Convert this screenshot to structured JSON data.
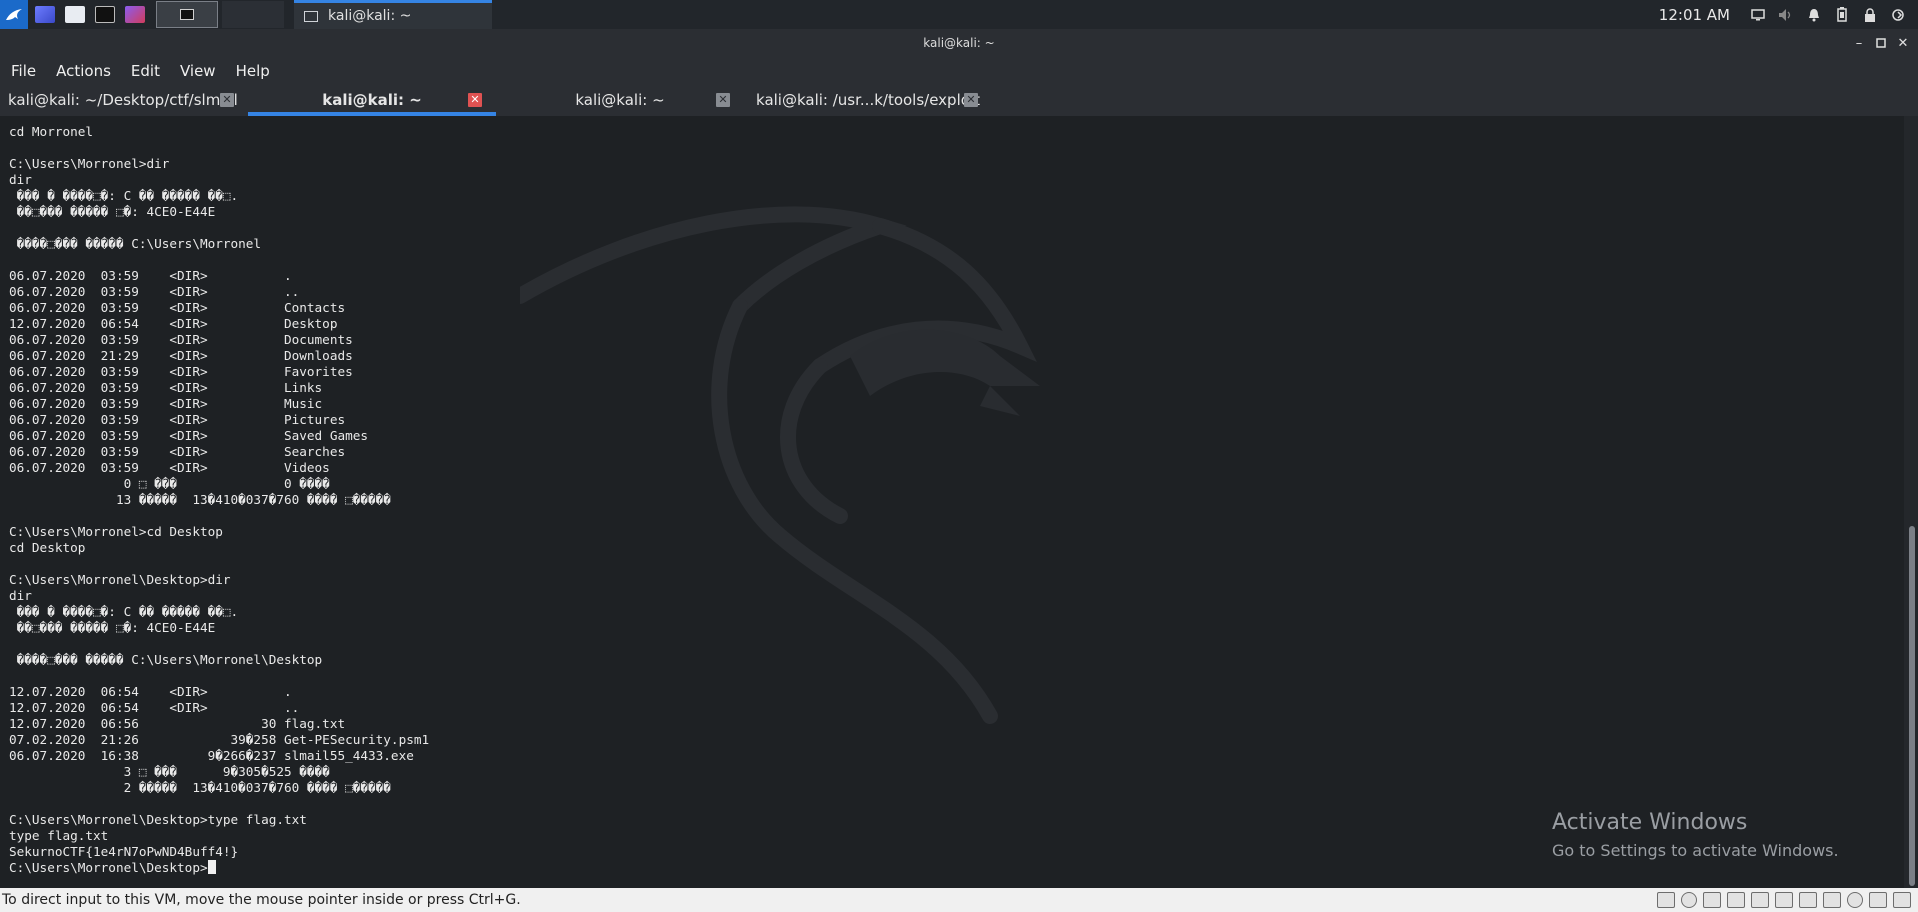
{
  "taskbar": {
    "task_label": "kali@kali: ~",
    "clock": "12:01 AM"
  },
  "window": {
    "title": "kali@kali: ~"
  },
  "menu": [
    "File",
    "Actions",
    "Edit",
    "View",
    "Help"
  ],
  "tabs": [
    {
      "label": "kali@kali: ~/Desktop/ctf/slmail",
      "active": false
    },
    {
      "label": "kali@kali: ~",
      "active": true
    },
    {
      "label": "kali@kali: ~",
      "active": false
    },
    {
      "label": "kali@kali: /usr...k/tools/exploit",
      "active": false
    }
  ],
  "terminal": {
    "lines": [
      "cd Morronel",
      "",
      "C:\\Users\\Morronel>dir",
      "dir",
      " ��� � ����⬚�: C �� ����� ��⬚.",
      " ��⬚��� ����� ⬚�: 4CE0-E44E",
      "",
      " ����⬚��� ����� C:\\Users\\Morronel",
      "",
      "06.07.2020  03:59    <DIR>          .",
      "06.07.2020  03:59    <DIR>          ..",
      "06.07.2020  03:59    <DIR>          Contacts",
      "12.07.2020  06:54    <DIR>          Desktop",
      "06.07.2020  03:59    <DIR>          Documents",
      "06.07.2020  21:29    <DIR>          Downloads",
      "06.07.2020  03:59    <DIR>          Favorites",
      "06.07.2020  03:59    <DIR>          Links",
      "06.07.2020  03:59    <DIR>          Music",
      "06.07.2020  03:59    <DIR>          Pictures",
      "06.07.2020  03:59    <DIR>          Saved Games",
      "06.07.2020  03:59    <DIR>          Searches",
      "06.07.2020  03:59    <DIR>          Videos",
      "               0 ⬚ ���              0 ����",
      "              13 �����  13�410�037�760 ���� ⬚�����",
      "",
      "C:\\Users\\Morronel>cd Desktop",
      "cd Desktop",
      "",
      "C:\\Users\\Morronel\\Desktop>dir",
      "dir",
      " ��� � ����⬚�: C �� ����� ��⬚.",
      " ��⬚��� ����� ⬚�: 4CE0-E44E",
      "",
      " ����⬚��� ����� C:\\Users\\Morronel\\Desktop",
      "",
      "12.07.2020  06:54    <DIR>          .",
      "12.07.2020  06:54    <DIR>          ..",
      "12.07.2020  06:56                30 flag.txt",
      "07.02.2020  21:26            39�258 Get-PESecurity.psm1",
      "06.07.2020  16:38         9�266�237 slmail55_4433.exe",
      "               3 ⬚ ���      9�305�525 ����",
      "               2 �����  13�410�037�760 ���� ⬚�����",
      "",
      "C:\\Users\\Morronel\\Desktop>type flag.txt",
      "type flag.txt",
      "SekurnoCTF{1e4rN7oPwND4Buff4!}"
    ],
    "prompt": "C:\\Users\\Morronel\\Desktop>"
  },
  "watermark": {
    "line1": "Activate Windows",
    "line2": "Go to Settings to activate Windows."
  },
  "statusbar": {
    "text": "To direct input to this VM, move the mouse pointer inside or press Ctrl+G."
  },
  "colors": {
    "accent": "#3584e4",
    "terminal_bg": "#1e2124",
    "close_active": "#e05252"
  }
}
